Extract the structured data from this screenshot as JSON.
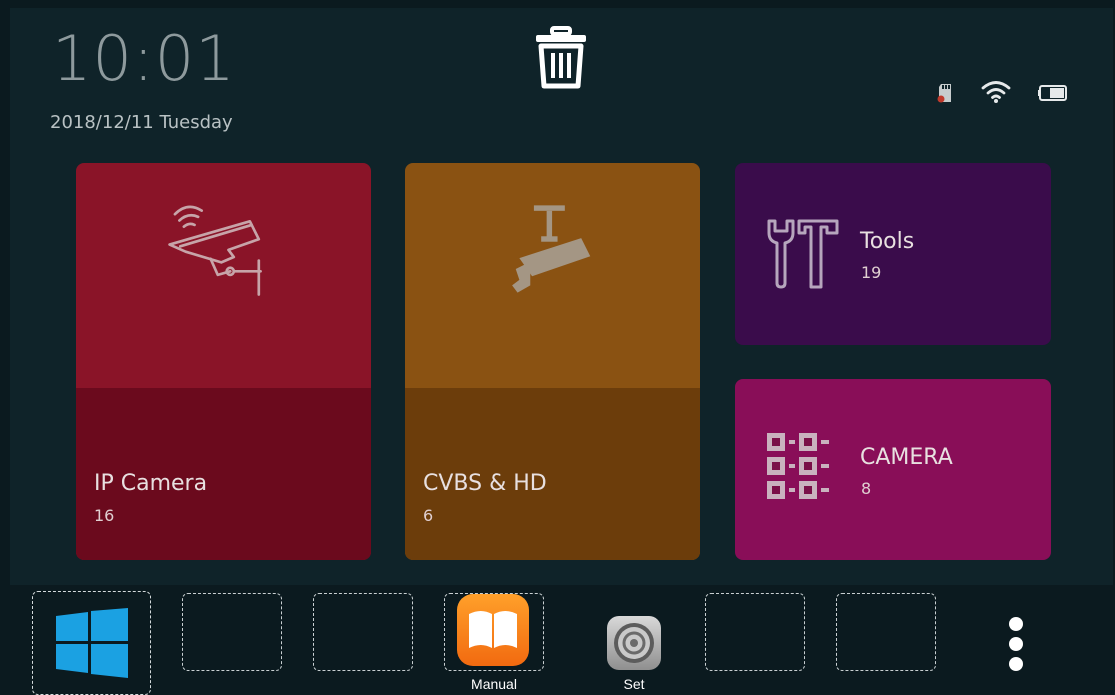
{
  "status_bar": {
    "time": "10:01",
    "date": "2018/12/11 Tuesday",
    "icons": [
      "sd-card-icon",
      "wifi-icon",
      "battery-icon"
    ]
  },
  "header": {
    "trash_icon": "trash-icon"
  },
  "tiles": [
    {
      "label": "IP Camera",
      "count": "16",
      "icon": "ip-camera-icon",
      "color": "#8a1428"
    },
    {
      "label": "CVBS & HD",
      "count": "6",
      "icon": "cctv-camera-icon",
      "color": "#8a5212"
    },
    {
      "label": "Tools",
      "count": "19",
      "icon": "tools-icon",
      "color": "#3a0c4b"
    },
    {
      "label": "CAMERA",
      "count": "8",
      "icon": "camera-grid-icon",
      "color": "#890e58"
    }
  ],
  "dock": {
    "apps": [
      {
        "label": "Manual",
        "icon": "book-icon",
        "color": "#f5871f"
      },
      {
        "label": "Set",
        "icon": "settings-gear-icon",
        "color": "#9a9a9a"
      }
    ],
    "start_icon": "windows-icon",
    "more_icon": "more-vertical-icon"
  }
}
